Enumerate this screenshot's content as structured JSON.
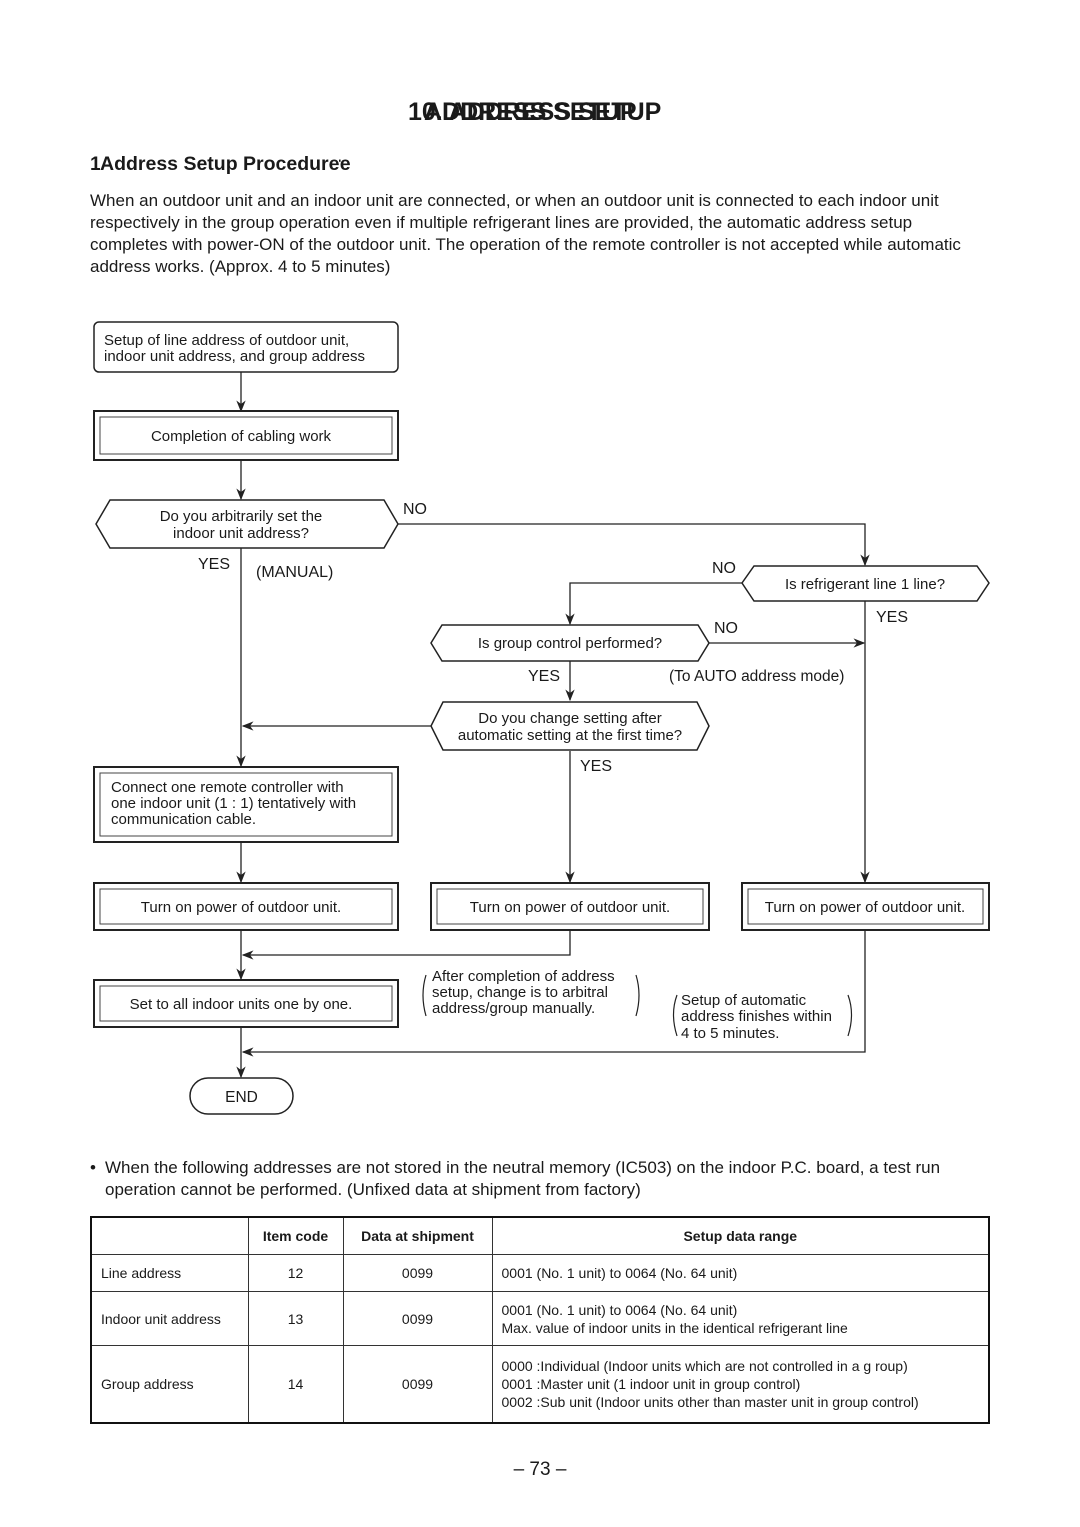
{
  "header": {
    "title_layers": [
      "10. ADDRESS SETUP",
      "ADDRESS SETUP"
    ],
    "subtitle_layers": [
      "10-1. Address Setup Procedure",
      "Address Setup Procedure"
    ]
  },
  "intro": {
    "text": "When an outdoor unit and an indoor unit are connected, or when an outdoor unit is connected to each indoor unit respectively in the group operation even if multiple refrigerant lines are provided, the automatic address setup completes with power-ON of the outdoor unit. The operation of the remote controller is not accepted while automatic address works. (Approx. 4 to 5 minutes)"
  },
  "flowchart": {
    "start": [
      "Setup of line address of outdoor unit,",
      "indoor unit address, and group address"
    ],
    "cabling": "Completion of cabling work",
    "q_arbitrary": [
      "Do you arbitrarily set the",
      "indoor unit address?"
    ],
    "q_refrigerant": "Is refrigerant line 1 line?",
    "q_group": "Is group control performed?",
    "q_change": [
      "Do you change setting after",
      "automatic setting at the first time?"
    ],
    "connect_remote": [
      "Connect one remote controller with",
      "one indoor unit (1 : 1) tentatively with",
      "communication cable."
    ],
    "power_on_1": "Turn on power of outdoor unit.",
    "power_on_2": "Turn on power of outdoor unit.",
    "power_on_3": "Turn on power of outdoor unit.",
    "set_all": "Set to all indoor units one by one.",
    "end": "END",
    "labels": {
      "no_arbitrary": "NO",
      "yes_arbitrary": "YES",
      "manual": "(MANUAL)",
      "no_refrigerant": "NO",
      "yes_refrigerant": "YES",
      "no_group": "NO",
      "yes_group": "YES",
      "auto_mode": "(To AUTO address mode)",
      "yes_change": "YES"
    },
    "note_manual": [
      "After completion of address",
      "setup, change is to arbitral",
      "address/group manually."
    ],
    "note_auto": [
      "Setup of automatic",
      "address finishes within",
      "4 to 5 minutes."
    ]
  },
  "note": {
    "bullet": "•",
    "text": "When the following addresses are not stored in the neutral memory (IC503) on the indoor P.C. board, a test run operation cannot be performed. (Unfixed data at shipment from factory)"
  },
  "table": {
    "headers": [
      "",
      "Item code",
      "Data at shipment",
      "Setup data range"
    ],
    "rows": [
      {
        "name": "Line address",
        "code": "12",
        "shipment": "0099",
        "range": [
          "0001 (No. 1 unit) to 0064 (No. 64 unit)"
        ]
      },
      {
        "name": "Indoor unit address",
        "code": "13",
        "shipment": "0099",
        "range": [
          "0001 (No. 1 unit) to 0064 (No. 64 unit)",
          "Max. value of indoor units in the identical refrigerant line"
        ]
      },
      {
        "name": "Group address",
        "code": "14",
        "shipment": "0099",
        "range": [
          "0000 :Individual (Indoor units which are not controlled in a g roup)",
          "0001 :Master unit (1 indoor unit in group control)",
          "0002 :Sub unit (Indoor units other than master unit in group control)"
        ]
      }
    ]
  },
  "footer": {
    "page_number": "– 73 –"
  }
}
